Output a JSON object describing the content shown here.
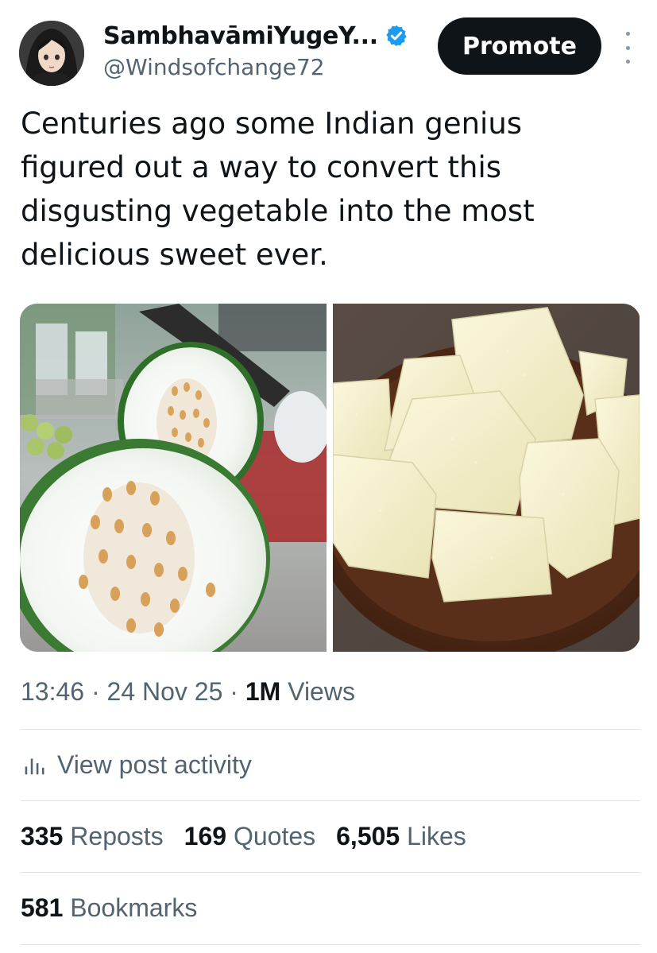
{
  "author": {
    "display_name": "SambhavāmiYugeY...",
    "handle": "@Windsofchange72",
    "verified_icon": "verified-badge-icon",
    "avatar_icon": "anime-girl-avatar"
  },
  "header": {
    "promote_label": "Promote",
    "more_icon": "more-options-icon"
  },
  "tweet": {
    "text": "Centuries ago some Indian genius\nfigured out a way to convert this\ndisgusting vegetable into the most\ndelicious sweet ever."
  },
  "media": {
    "left_icon": "ash-gourd-photo",
    "right_icon": "petha-sweet-photo"
  },
  "meta": {
    "time": "13:46",
    "sep1": " · ",
    "date": "24 Nov 25",
    "sep2": " · ",
    "views_count": "1M",
    "views_label": " Views"
  },
  "activity": {
    "label": "View post activity",
    "icon": "analytics-icon"
  },
  "stats": {
    "reposts_count": "335",
    "reposts_label": " Reposts",
    "quotes_count": "169",
    "quotes_label": " Quotes",
    "likes_count": "6,505",
    "likes_label": " Likes",
    "bookmarks_count": "581",
    "bookmarks_label": " Bookmarks"
  },
  "colors": {
    "text_primary": "#0f1419",
    "text_secondary": "#536471",
    "verified_blue": "#1d9bf0",
    "promote_bg": "#0f1419",
    "divider": "#dfe3e7"
  }
}
